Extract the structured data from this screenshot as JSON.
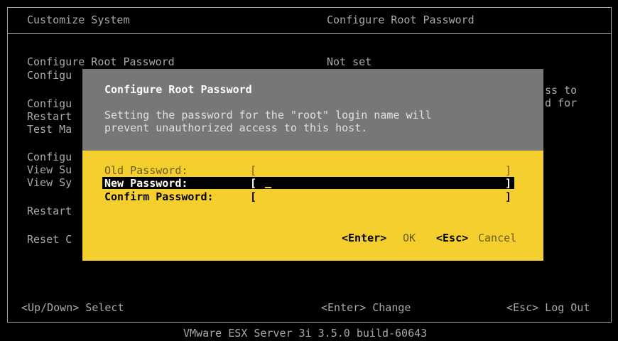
{
  "header": {
    "left_title": "Customize System",
    "right_title": "Configure Root Password"
  },
  "menu": {
    "items": [
      "Configure Root Password",
      "Configu",
      "Configu",
      "Restart",
      "Test Ma",
      "Configu",
      "View Su",
      "View Sy",
      "Restart",
      "Reset C"
    ]
  },
  "detail": {
    "status": "Not set",
    "fragment_line1": "ss to",
    "fragment_line2": "d for"
  },
  "dialog": {
    "title": "Configure Root Password",
    "description_line1": "Setting the password for the \"root\" login name will",
    "description_line2": "prevent unauthorized access to this host.",
    "fields": [
      {
        "label": "Old Password:",
        "value": ""
      },
      {
        "label": "New Password:",
        "value": ""
      },
      {
        "label": "Confirm Password:",
        "value": ""
      }
    ],
    "bracket_open": "[",
    "bracket_close": "]",
    "enter_key": "<Enter>",
    "ok_label": "OK",
    "esc_key": "<Esc>",
    "cancel_label": "Cancel"
  },
  "hints": {
    "select": "<Up/Down> Select",
    "change": "<Enter> Change",
    "logout": "<Esc> Log Out"
  },
  "footer": {
    "product": "VMware ESX Server 3i 3.5.0 build-60643"
  }
}
